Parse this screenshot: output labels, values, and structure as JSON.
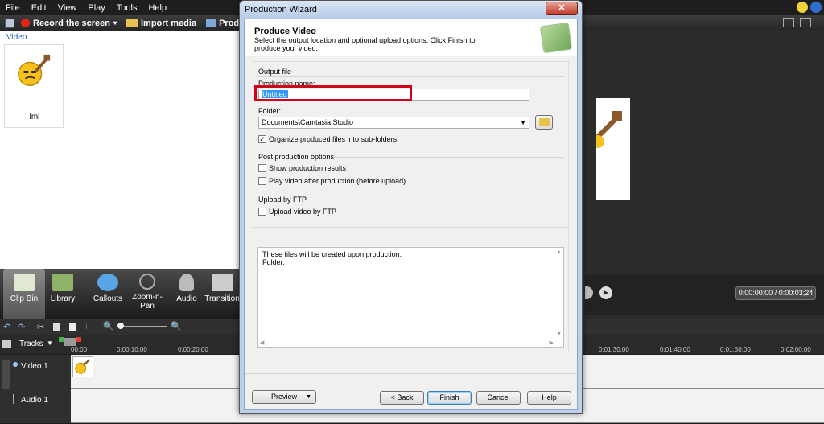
{
  "menu": [
    "File",
    "Edit",
    "View",
    "Play",
    "Tools",
    "Help"
  ],
  "toolbar": {
    "record": "Record the screen",
    "import": "Import media",
    "produce": "Produc"
  },
  "clipbin": {
    "header": "Video",
    "clip_label": "lml"
  },
  "tasks": [
    "Clip Bin",
    "Library",
    "Callouts",
    "Zoom-n-\nPan",
    "Audio",
    "Transition"
  ],
  "timeline": {
    "tracks_label": "Tracks",
    "ticks": [
      "00;00",
      "0:00:10;00",
      "0:00:20;00",
      "0:01:30;00",
      "0:01:40;00",
      "0:01:50;00",
      "0:02:00;00"
    ],
    "video_track": "Video 1",
    "audio_track": "Audio 1"
  },
  "player": {
    "timecode": "0:00:00;00 / 0:00:03;24"
  },
  "dialog": {
    "title": "Production Wizard",
    "heading": "Produce Video",
    "description": "Select the output location and optional upload options. Click Finish to produce your video.",
    "output_group": "Output file",
    "production_name_label": "Production name:",
    "production_name_value": "Untitled",
    "folder_label": "Folder:",
    "folder_value": "Documents\\Camtasia Studio",
    "organize_label": "Organize produced files into sub-folders",
    "organize_checked": "✓",
    "post_group": "Post production options",
    "show_results_label": "Show production results",
    "play_after_label": "Play video after production (before upload)",
    "ftp_group": "Upload by FTP",
    "ftp_label": "Upload video by FTP",
    "info_line1": "These files will be created upon production:",
    "info_line2": "Folder:",
    "buttons": {
      "preview": "Preview",
      "back": "< Back",
      "finish": "Finish",
      "cancel": "Cancel",
      "help": "Help"
    },
    "close_glyph": "✕"
  },
  "colors": {
    "highlight_border": "#d0021b",
    "selection": "#3399ff"
  }
}
